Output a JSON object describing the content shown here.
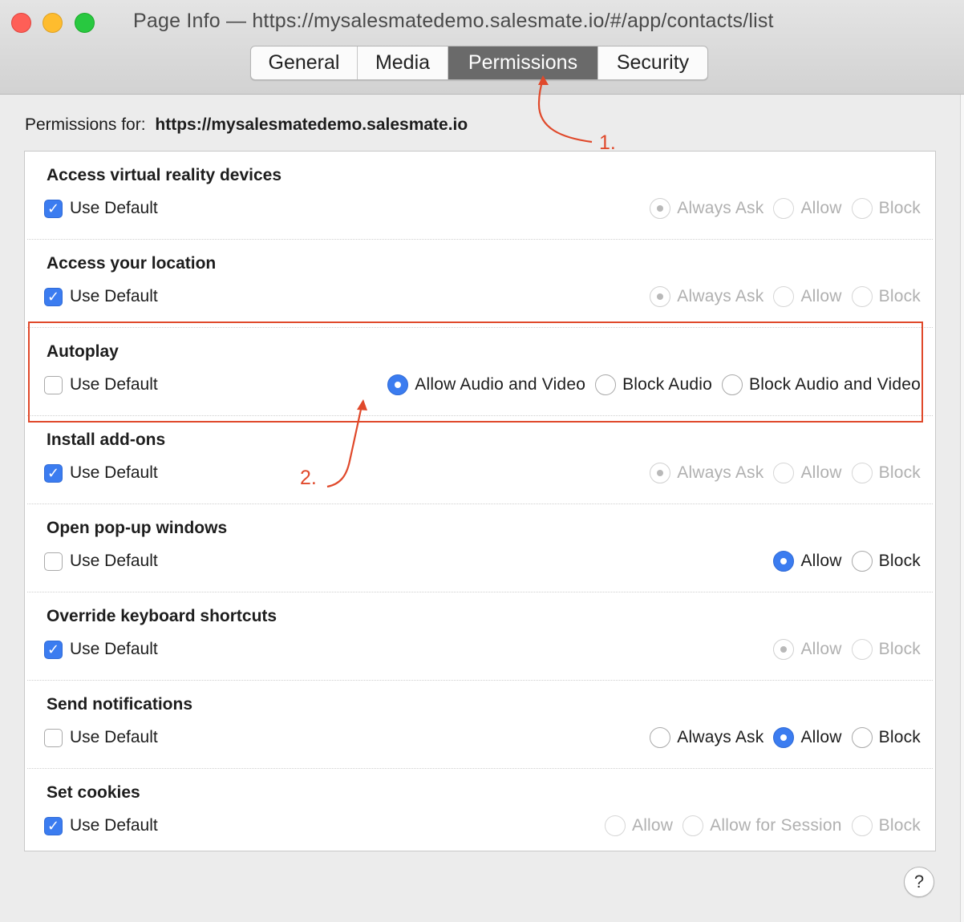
{
  "window": {
    "title": "Page Info — https://mysalesmatedemo.salesmate.io/#/app/contacts/list",
    "tabs": [
      "General",
      "Media",
      "Permissions",
      "Security"
    ],
    "active_tab": "Permissions"
  },
  "permissions_for": {
    "label": "Permissions for:",
    "host": "https://mysalesmatedemo.salesmate.io"
  },
  "use_default_label": "Use Default",
  "permissions": [
    {
      "title": "Access virtual reality devices",
      "use_default": true,
      "disabled": true,
      "options": [
        {
          "label": "Always Ask",
          "selected": true
        },
        {
          "label": "Allow",
          "selected": false
        },
        {
          "label": "Block",
          "selected": false
        }
      ]
    },
    {
      "title": "Access your location",
      "use_default": true,
      "disabled": true,
      "options": [
        {
          "label": "Always Ask",
          "selected": true
        },
        {
          "label": "Allow",
          "selected": false
        },
        {
          "label": "Block",
          "selected": false
        }
      ]
    },
    {
      "title": "Autoplay",
      "use_default": false,
      "disabled": false,
      "options": [
        {
          "label": "Allow Audio and Video",
          "selected": true
        },
        {
          "label": "Block Audio",
          "selected": false
        },
        {
          "label": "Block Audio and Video",
          "selected": false
        }
      ]
    },
    {
      "title": "Install add-ons",
      "use_default": true,
      "disabled": true,
      "options": [
        {
          "label": "Always Ask",
          "selected": true
        },
        {
          "label": "Allow",
          "selected": false
        },
        {
          "label": "Block",
          "selected": false
        }
      ]
    },
    {
      "title": "Open pop-up windows",
      "use_default": false,
      "disabled": false,
      "options": [
        {
          "label": "Allow",
          "selected": true
        },
        {
          "label": "Block",
          "selected": false
        }
      ]
    },
    {
      "title": "Override keyboard shortcuts",
      "use_default": true,
      "disabled": true,
      "options": [
        {
          "label": "Allow",
          "selected": true
        },
        {
          "label": "Block",
          "selected": false
        }
      ]
    },
    {
      "title": "Send notifications",
      "use_default": false,
      "disabled": false,
      "options": [
        {
          "label": "Always Ask",
          "selected": false
        },
        {
          "label": "Allow",
          "selected": true
        },
        {
          "label": "Block",
          "selected": false
        }
      ]
    },
    {
      "title": "Set cookies",
      "use_default": true,
      "disabled": true,
      "options": [
        {
          "label": "Allow",
          "selected": false
        },
        {
          "label": "Allow for Session",
          "selected": false
        },
        {
          "label": "Block",
          "selected": false
        }
      ]
    }
  ],
  "annotations": [
    "1.",
    "2."
  ],
  "annotation_color": "#e0492b",
  "accent_color": "#3b7cf0",
  "help_button": "?"
}
